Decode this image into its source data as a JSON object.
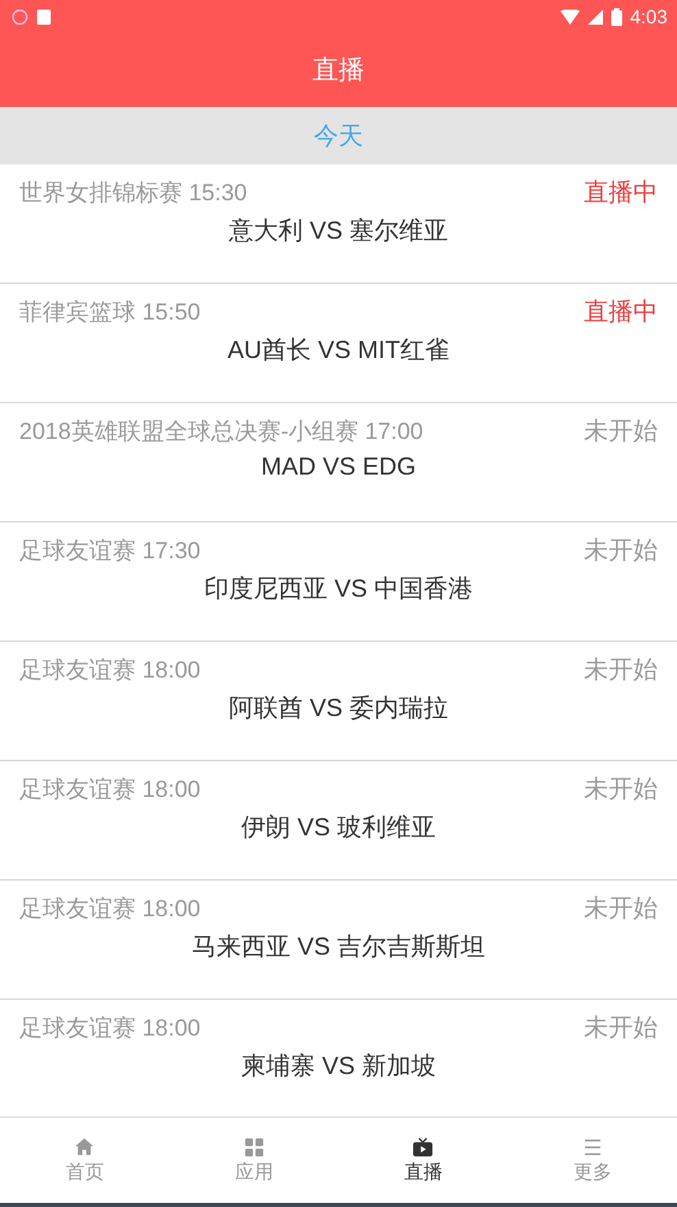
{
  "status_bar": {
    "time": "4:03"
  },
  "header": {
    "title": "直播"
  },
  "section": {
    "title": "今天"
  },
  "matches": [
    {
      "league": "世界女排锦标赛 15:30",
      "teams": "意大利 VS 塞尔维亚",
      "status": "直播中",
      "live": true
    },
    {
      "league": "菲律宾篮球 15:50",
      "teams": "AU酋长 VS MIT红雀",
      "status": "直播中",
      "live": true
    },
    {
      "league": "2018英雄联盟全球总决赛-小组赛 17:00",
      "teams": "MAD VS EDG",
      "status": "未开始",
      "live": false
    },
    {
      "league": "足球友谊赛 17:30",
      "teams": "印度尼西亚 VS 中国香港",
      "status": "未开始",
      "live": false
    },
    {
      "league": "足球友谊赛 18:00",
      "teams": "阿联酋 VS 委内瑞拉",
      "status": "未开始",
      "live": false
    },
    {
      "league": "足球友谊赛 18:00",
      "teams": "伊朗 VS 玻利维亚",
      "status": "未开始",
      "live": false
    },
    {
      "league": "足球友谊赛 18:00",
      "teams": "马来西亚 VS 吉尔吉斯斯坦",
      "status": "未开始",
      "live": false
    },
    {
      "league": "足球友谊赛 18:00",
      "teams": "柬埔寨 VS 新加坡",
      "status": "未开始",
      "live": false
    }
  ],
  "tabs": [
    {
      "label": "首页",
      "kind": "home",
      "selected": false
    },
    {
      "label": "应用",
      "kind": "apps",
      "selected": false
    },
    {
      "label": "直播",
      "kind": "tv",
      "selected": true
    },
    {
      "label": "更多",
      "kind": "more",
      "selected": false
    }
  ]
}
